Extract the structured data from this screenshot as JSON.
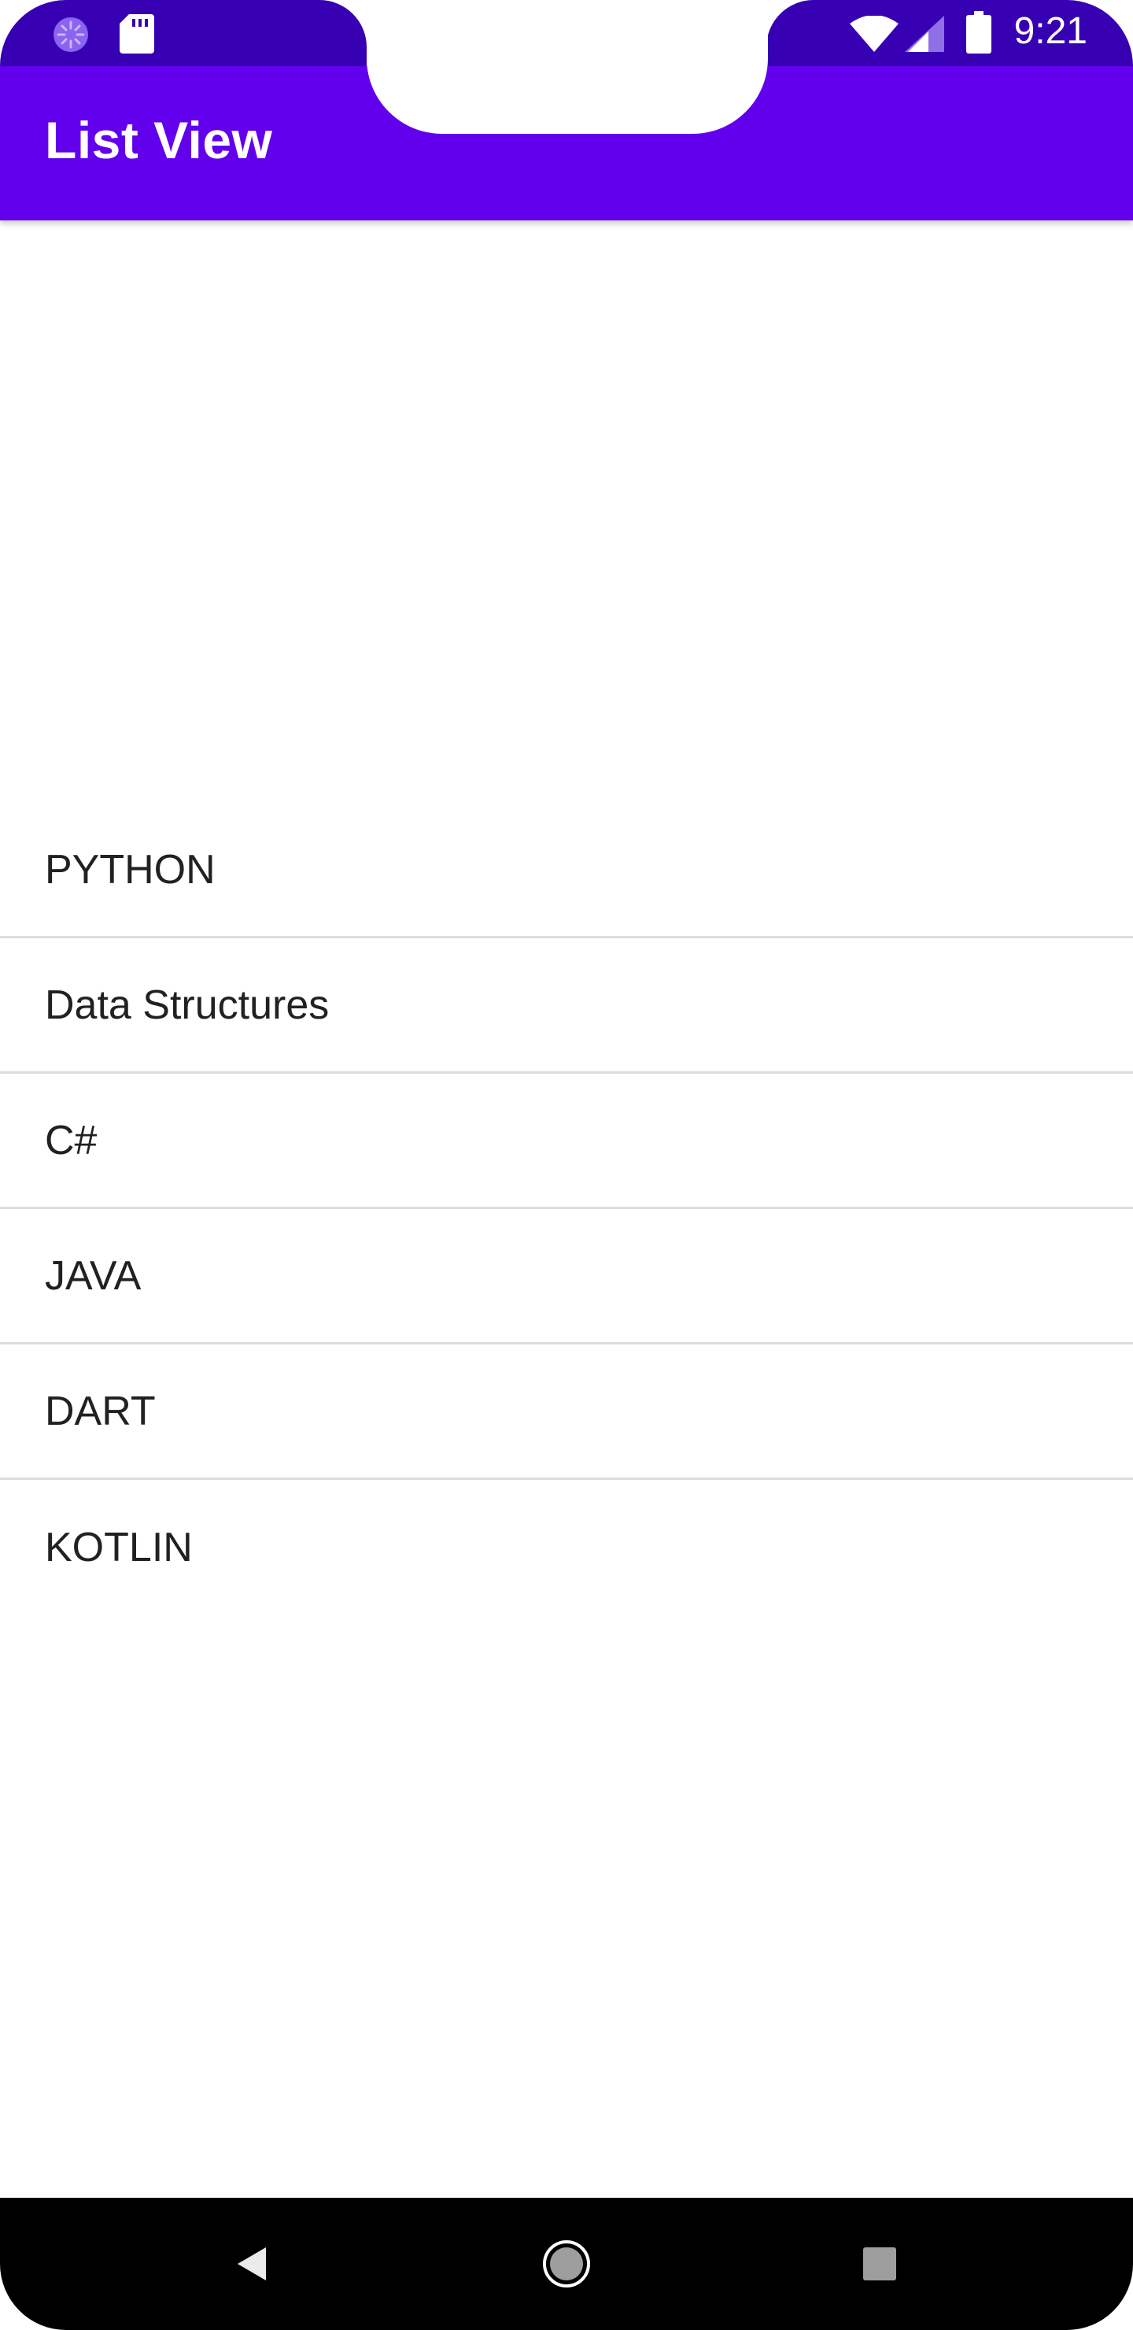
{
  "status_bar": {
    "time": "9:21",
    "icons": [
      "loading-icon",
      "sd-card-icon",
      "wifi-icon",
      "signal-icon",
      "battery-icon"
    ]
  },
  "app_bar": {
    "title": "List View"
  },
  "list": {
    "items": [
      {
        "label": "PYTHON"
      },
      {
        "label": "Data Structures"
      },
      {
        "label": "C#"
      },
      {
        "label": "JAVA"
      },
      {
        "label": "DART"
      },
      {
        "label": "KOTLIN"
      }
    ]
  },
  "nav_bar": {
    "icons": [
      "back-icon",
      "home-icon",
      "recents-icon"
    ]
  },
  "colors": {
    "status_bar": "#3700b3",
    "app_bar": "#6200ee",
    "text": "#212121",
    "divider": "#dcdcdc"
  }
}
